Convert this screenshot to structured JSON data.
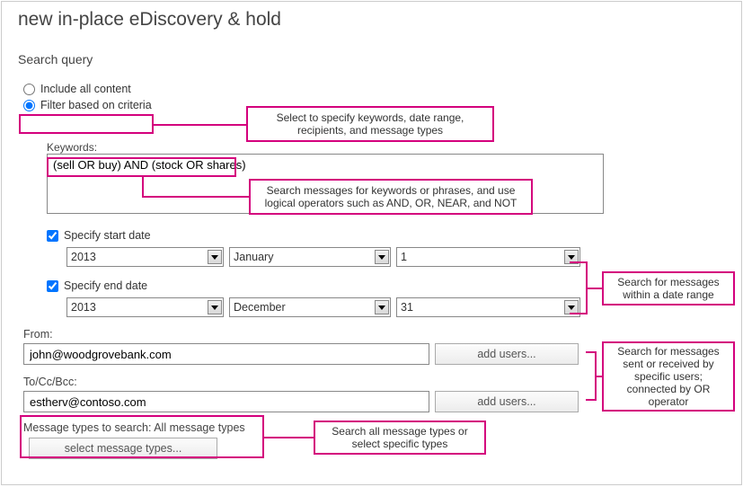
{
  "pageTitle": "new in-place eDiscovery & hold",
  "sectionTitle": "Search query",
  "radios": {
    "includeAll": "Include all content",
    "filterCriteria": "Filter based on criteria"
  },
  "keywordsLabel": "Keywords:",
  "keywordsValue": "(sell OR buy) AND (stock OR shares)",
  "specifyStart": "Specify start date",
  "specifyEnd": "Specify end date",
  "startYear": "2013",
  "startMonth": "January",
  "startDay": "1",
  "endYear": "2013",
  "endMonth": "December",
  "endDay": "31",
  "fromLabel": "From:",
  "fromValue": "john@woodgrovebank.com",
  "toLabel": "To/Cc/Bcc:",
  "toValue": "estherv@contoso.com",
  "addUsers": "add users...",
  "msgTypesLabel": "Message types to search:  All message types",
  "selectTypes": "select message types...",
  "callouts": {
    "filter": "Select to specify keywords, date range, recipients, and message types",
    "keywords": "Search messages for keywords or phrases, and use logical operators such as AND, OR, NEAR, and NOT",
    "dates": "Search for messages within a date range",
    "users": "Search for messages sent or received by specific users; connected by OR operator",
    "types": "Search all message types or select specific types"
  }
}
